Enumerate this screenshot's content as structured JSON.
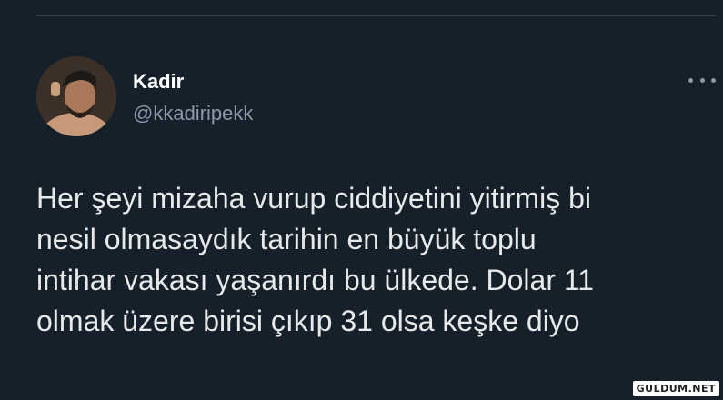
{
  "colors": {
    "background": "#15202b",
    "text_primary": "#e7e9ea",
    "text_secondary": "#8b98a5",
    "divider": "#38444d"
  },
  "tweet": {
    "author_name": "Kadir",
    "author_handle": "@kkadiripekk",
    "avatar_icon": "profile-photo",
    "more_icon": "more-horizontal-icon",
    "text_lines": [
      "Her şeyi mizaha vurup ciddiyetini yitirmiş bi",
      "nesil olmasaydık tarihin en büyük toplu",
      "intihar vakası yaşanırdı bu ülkede. Dolar 11",
      "olmak üzere birisi çıkıp 31 olsa keşke diyo"
    ]
  },
  "watermark": "GULDUM.NET"
}
